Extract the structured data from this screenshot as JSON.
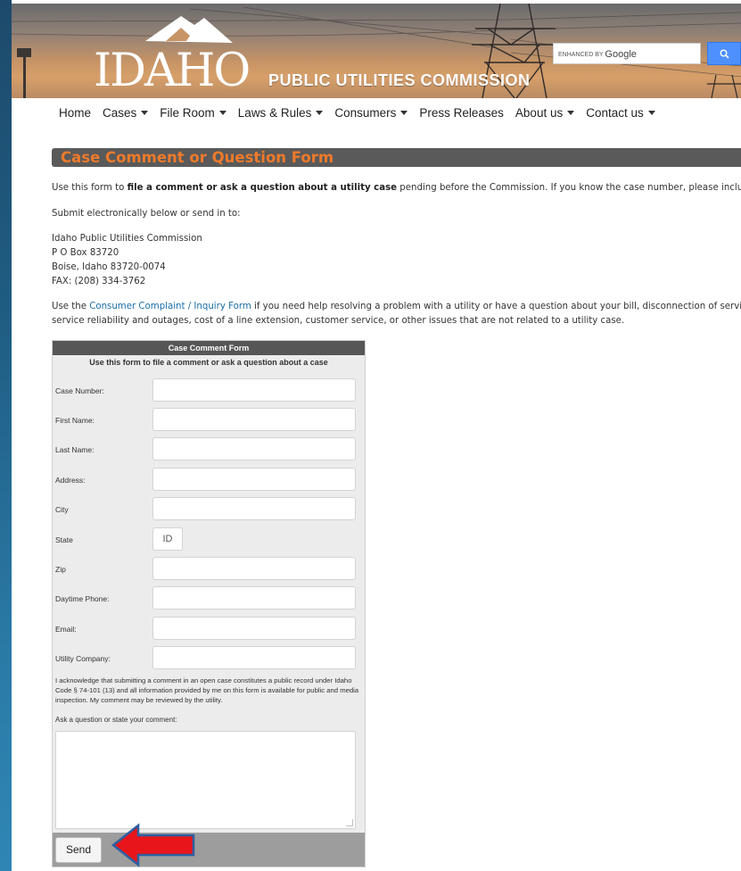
{
  "header": {
    "logo_text": "IDAHO",
    "agency_name": "PUBLIC UTILITIES COMMISSION",
    "search": {
      "placeholder": "enhanced by Google",
      "watermark_prefix": "ENHANCED BY",
      "watermark_brand": "Google",
      "button_icon": "search-icon"
    }
  },
  "nav": {
    "items": [
      {
        "label": "Home",
        "dropdown": false
      },
      {
        "label": "Cases",
        "dropdown": true
      },
      {
        "label": "File Room",
        "dropdown": true
      },
      {
        "label": "Laws & Rules",
        "dropdown": true
      },
      {
        "label": "Consumers",
        "dropdown": true
      },
      {
        "label": "Press Releases",
        "dropdown": false
      },
      {
        "label": "About us",
        "dropdown": true
      },
      {
        "label": "Contact us",
        "dropdown": true
      }
    ]
  },
  "main": {
    "title": "Case Comment or Question Form",
    "intro_pre": "Use this form to ",
    "intro_bold": "file a comment or ask a question about a utility case",
    "intro_post": " pending before the Commission. If you know the case number, please include it.",
    "submit_note": "Submit electronically below or send in to:",
    "address": [
      "Idaho Public Utilities Commission",
      "P O Box 83720",
      "Boise, Idaho 83720-0074",
      "FAX: (208) 334-3762"
    ],
    "consumer_pre": "Use the ",
    "consumer_link": "Consumer Complaint / Inquiry Form",
    "consumer_post_1": " if you need help resolving a problem with a utility or have a question about your bill, disconnection of service,",
    "consumer_post_2": "service reliability and outages, cost of a line extension, customer service, or other issues that are not related to a utility case."
  },
  "form": {
    "title": "Case Comment Form",
    "subtitle": "Use this form to file a comment or ask a question about a case",
    "fields": [
      {
        "label": "Case Number:",
        "value": ""
      },
      {
        "label": "First Name:",
        "value": ""
      },
      {
        "label": "Last Name:",
        "value": ""
      },
      {
        "label": "Address:",
        "value": ""
      },
      {
        "label": "City",
        "value": ""
      },
      {
        "label": "State",
        "value": "ID"
      },
      {
        "label": "Zip",
        "value": ""
      },
      {
        "label": "Daytime Phone:",
        "value": ""
      },
      {
        "label": "Email:",
        "value": ""
      },
      {
        "label": "Utility Company:",
        "value": ""
      }
    ],
    "acknowledgement": "I acknowledge that submitting a comment in an open case constitutes a public record under Idaho Code § 74-101 (13) and all information provided by me on this form is available for public and media inspection. My comment may be reviewed by the utility.",
    "comment_label": "Ask a question or state your comment:",
    "comment_value": "",
    "send_label": "Send"
  },
  "annotation": {
    "arrow_color": "#e8151b",
    "arrow_outline": "#2d5fa3"
  }
}
